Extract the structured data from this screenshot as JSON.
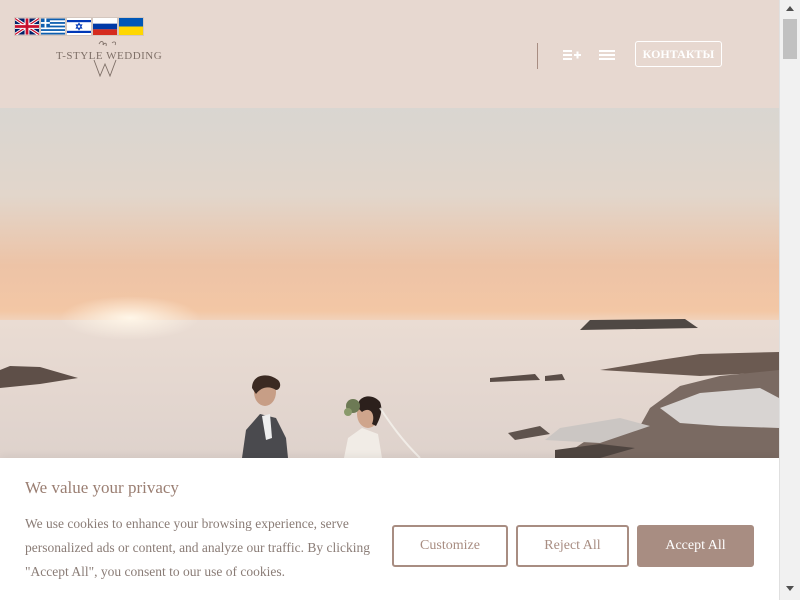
{
  "header": {
    "flags": [
      {
        "name": "english-flag"
      },
      {
        "name": "greek-flag"
      },
      {
        "name": "israeli-flag"
      },
      {
        "name": "russian-flag"
      },
      {
        "name": "ukrainian-flag"
      }
    ],
    "logo_text": "T-STYLE WEDDING",
    "contacts_label": "КОНТАКТЫ",
    "icons": [
      "list-add-icon",
      "menu-icon"
    ]
  },
  "colors": {
    "header_bg": "#e7d8d0",
    "accent": "#a88d82",
    "banner_bg": "#ffffff"
  },
  "cookie_banner": {
    "title": "We value your privacy",
    "text": "We use cookies to enhance your browsing experience, serve personalized ads or content, and analyze our traffic. By clicking \"Accept All\", you consent to our use of cookies.",
    "customize_label": "Customize",
    "reject_label": "Reject All",
    "accept_label": "Accept All"
  }
}
